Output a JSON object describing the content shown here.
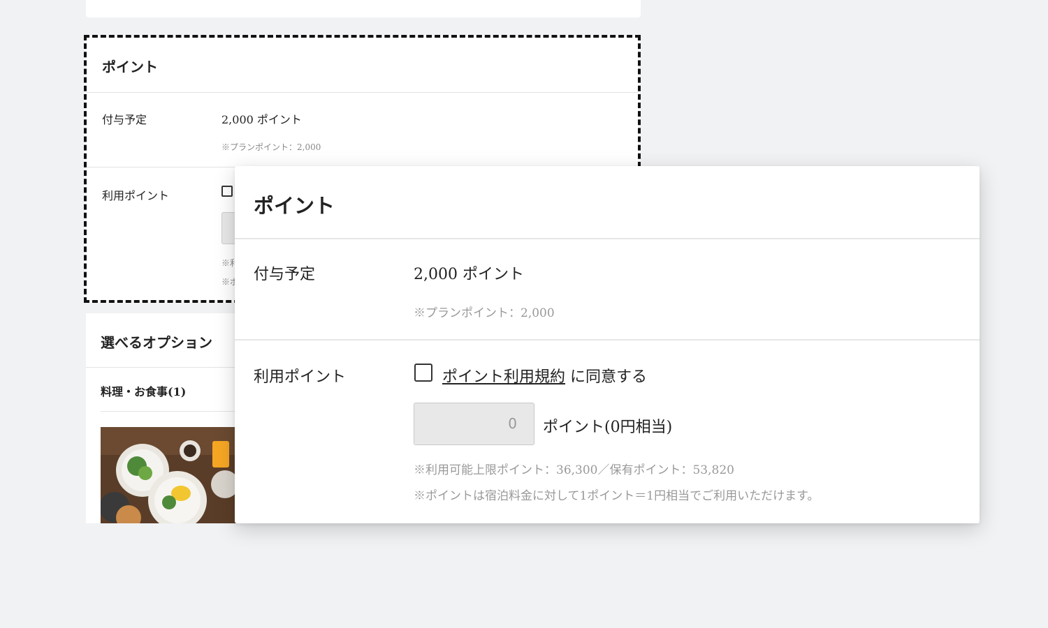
{
  "background_card": {
    "title": "ポイント",
    "grant_label": "付与予定",
    "grant_value": "2,000 ポイント",
    "plan_note": "※プランポイント：2,000",
    "use_label": "利用ポイント",
    "note_prefix_1": "※利",
    "note_prefix_2": "※ポ"
  },
  "options": {
    "title": "選べるオプション",
    "category": "料理・お食事(1)"
  },
  "zoom_card": {
    "title": "ポイント",
    "grant_label": "付与予定",
    "grant_value": "2,000 ポイント",
    "plan_note": "※プランポイント：2,000",
    "use_label": "利用ポイント",
    "terms_link": "ポイント利用規約",
    "terms_suffix": " に同意する",
    "points_input_value": "0",
    "points_unit": "ポイント(0円相当)",
    "limit_note": "※利用可能上限ポイント：36,300／保有ポイント：53,820",
    "rate_note": "※ポイントは宿泊料金に対して1ポイント＝1円相当でご利用いただけます。"
  },
  "colors": {
    "page_bg": "#f1f2f4",
    "card_bg": "#ffffff",
    "dashed_border": "#111111",
    "muted_text": "#999999",
    "input_bg": "#e8e8e8"
  },
  "icons": {
    "checkbox": "checkbox-unchecked-icon"
  }
}
